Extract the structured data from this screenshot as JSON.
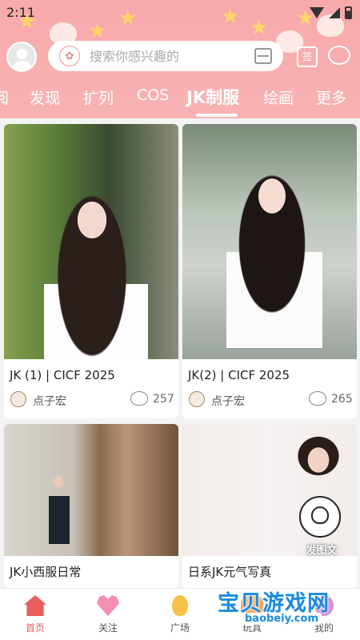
{
  "statusbar": {
    "time": "2:11"
  },
  "search": {
    "placeholder": "搜索你感兴趣的"
  },
  "header_icons": {
    "checkin": "签",
    "chat": "💬"
  },
  "tabs": [
    {
      "label": "阅"
    },
    {
      "label": "发现"
    },
    {
      "label": "扩列"
    },
    {
      "label": "COS"
    },
    {
      "label": "JK制服",
      "active": true
    },
    {
      "label": "绘画"
    },
    {
      "label": "更多"
    }
  ],
  "cards": [
    {
      "title": "JK (1) | CICF 2025",
      "author": "点子宏",
      "likes": "257"
    },
    {
      "title": "JK(2) | CICF 2025",
      "author": "点子宏",
      "likes": "265"
    },
    {
      "title": "JK小西服日常",
      "author": "",
      "likes": ""
    },
    {
      "title": "日系JK元气写真",
      "author": "",
      "likes": ""
    }
  ],
  "post_button": {
    "label": "发图文"
  },
  "bottomnav": [
    {
      "label": "首页",
      "icon": "home-icon",
      "active": true
    },
    {
      "label": "关注",
      "icon": "heart-icon"
    },
    {
      "label": "广场",
      "icon": "balloon-icon"
    },
    {
      "label": "玩具",
      "icon": "game-icon"
    },
    {
      "label": "我的",
      "icon": "profile-icon"
    }
  ],
  "watermark": {
    "text": "宝贝游戏网",
    "url": "baobeiy.com"
  },
  "colors": {
    "header": "#f7a9aa",
    "accent": "#e85c5c"
  }
}
